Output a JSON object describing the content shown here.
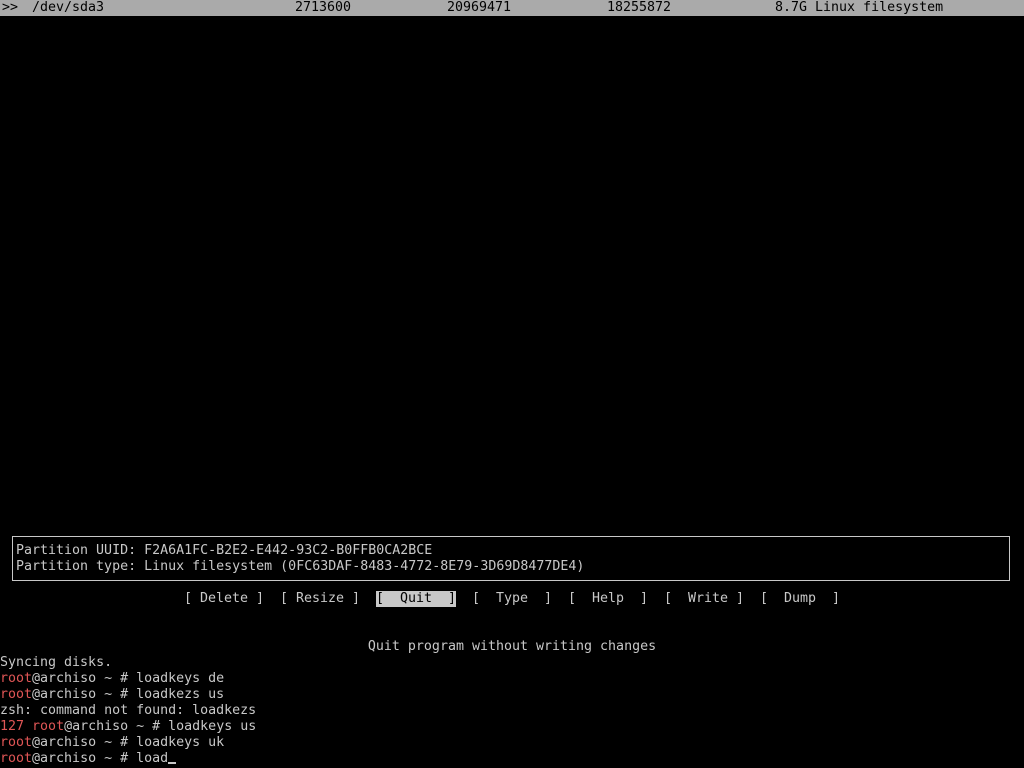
{
  "partition_row": {
    "marker": ">>",
    "device": "/dev/sda3",
    "start": "2713600",
    "end": "20969471",
    "sectors": "18255872",
    "size_type": "8.7G Linux filesystem"
  },
  "info": {
    "uuid_line": "Partition UUID: F2A6A1FC-B2E2-E442-93C2-B0FFB0CA2BCE",
    "type_line": "Partition type: Linux filesystem (0FC63DAF-8483-4772-8E79-3D69D8477DE4)"
  },
  "menu": {
    "delete": "[ Delete ]",
    "resize": "[ Resize ]",
    "quit": "[  Quit  ]",
    "type": "[  Type  ]",
    "help": "[  Help  ]",
    "write": "[  Write ]",
    "dump": "[  Dump  ]"
  },
  "hint": "Quit program without writing changes",
  "terminal": {
    "syncing": "Syncing disks.",
    "user": "root",
    "host_prompt": "@archiso ~ # ",
    "cmd1": "loadkeys de",
    "cmd2": "loadkezs us",
    "error": "zsh: command not found: loadkezs",
    "exit_code": "127",
    "cmd3": "loadkeys us",
    "cmd4": "loadkeys uk",
    "cmd5": "load"
  },
  "colors": {
    "background": "#000000",
    "text": "#c8c8c8",
    "highlight": "#aaaaaa",
    "prompt_red": "#e05656"
  }
}
